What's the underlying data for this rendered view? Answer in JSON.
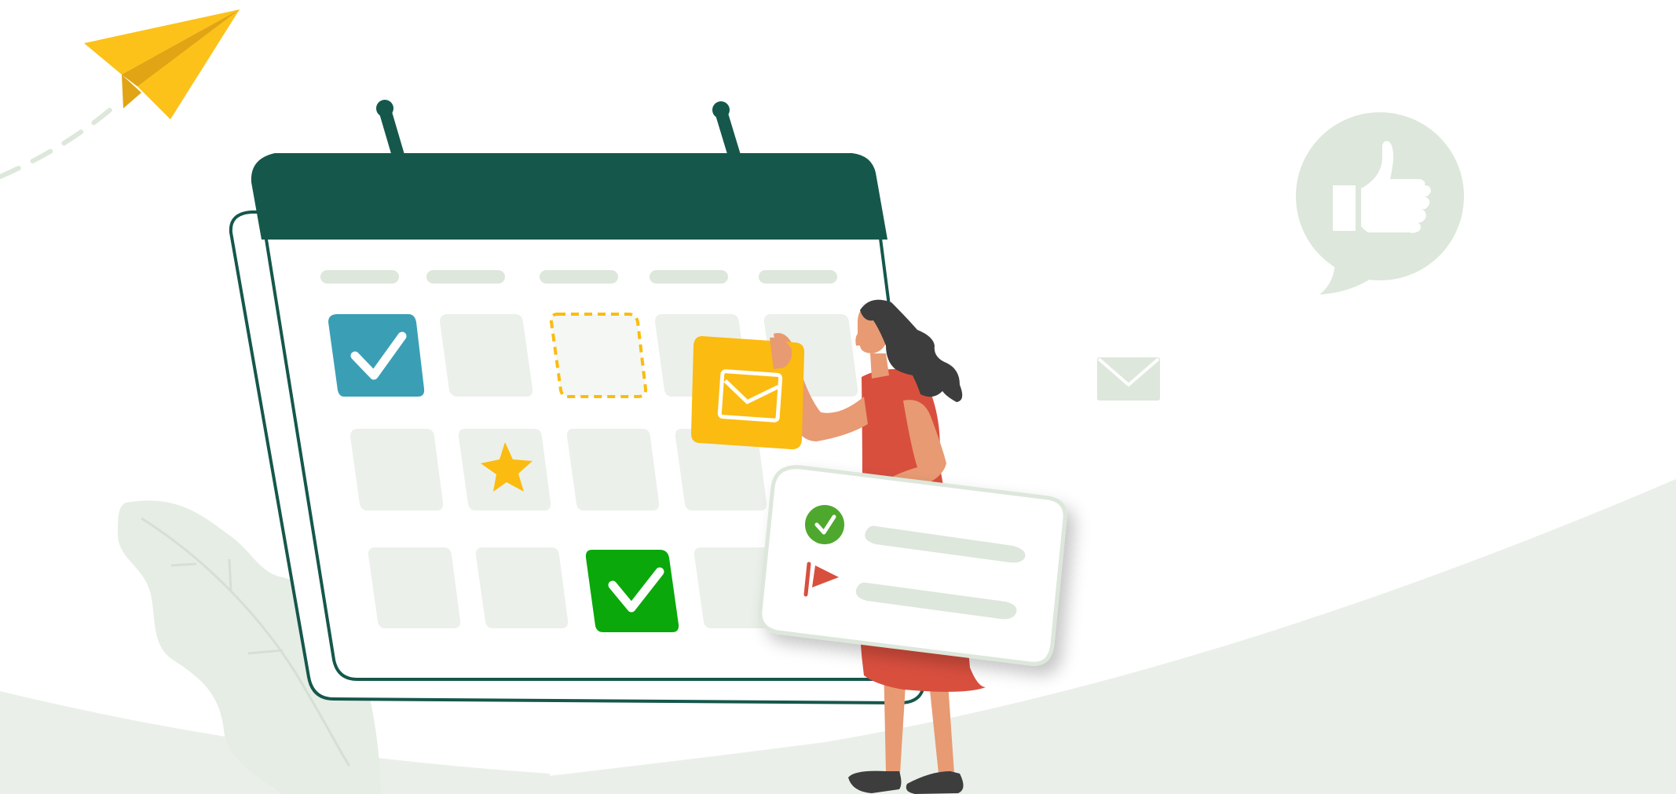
{
  "illustration": {
    "subject": "calendar-scheduling",
    "colors": {
      "background": "#ffffff",
      "hill": "#eaf0e9",
      "calendar_header": "#15574b",
      "calendar_outline": "#15574b",
      "cell": "#ebf0ea",
      "pill": "#dde7db",
      "check_teal": "#3a9fb5",
      "check_green": "#0aa80a",
      "star": "#fbbb10",
      "envelope_card": "#fbbb10",
      "plane_light": "#fcc21a",
      "plane_dark": "#e0a414",
      "dress": "#d94f3e",
      "skin": "#e89a73",
      "hair": "#3d3d3d",
      "panel_check": "#4ea82e",
      "panel_flag": "#d94f3e",
      "thumbs_bubble": "#dde7db"
    },
    "icons": [
      "paper-plane-icon",
      "thumbs-up-icon",
      "envelope-icon",
      "check-icon",
      "star-icon",
      "flag-icon"
    ]
  }
}
